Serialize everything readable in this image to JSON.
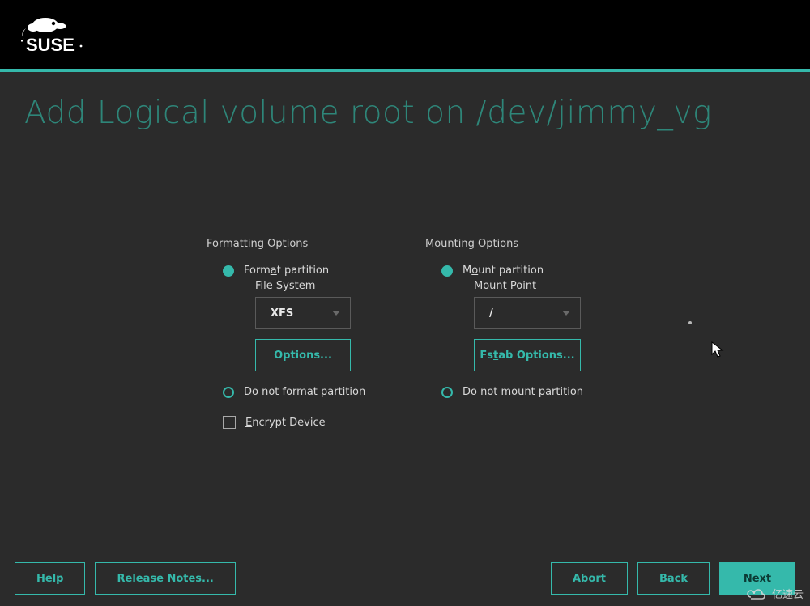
{
  "brand": "SUSE",
  "page_title": "Add Logical volume root on /dev/jimmy_vg",
  "formatting": {
    "group_label": "Formatting Options",
    "format_partition": {
      "pre": "Form",
      "u": "a",
      "post": "t partition",
      "selected": true
    },
    "file_system_label": {
      "pre": "File ",
      "u": "S",
      "post": "ystem"
    },
    "file_system_value": "XFS",
    "options_button": "Options...",
    "no_format": {
      "u": "D",
      "post": "o not format partition",
      "selected": false
    },
    "encrypt": {
      "u": "E",
      "post": "ncrypt Device",
      "checked": false
    }
  },
  "mounting": {
    "group_label": "Mounting Options",
    "mount_partition": {
      "pre": "M",
      "u": "o",
      "post": "unt partition",
      "selected": true
    },
    "mount_point_label": {
      "u": "M",
      "post": "ount Point"
    },
    "mount_point_value": "/",
    "fstab_button": {
      "pre": "Fs",
      "u": "t",
      "post": "ab Options..."
    },
    "no_mount": {
      "label": "Do not mount partition",
      "selected": false
    }
  },
  "footer": {
    "help": {
      "u": "H",
      "post": "elp"
    },
    "release_notes": {
      "pre": "Re",
      "u": "l",
      "post": "ease Notes..."
    },
    "abort": {
      "pre": "Abo",
      "u": "r",
      "post": "t"
    },
    "back": {
      "u": "B",
      "post": "ack"
    },
    "next": {
      "u": "N",
      "post": "ext"
    }
  },
  "watermark": "亿速云",
  "colors": {
    "accent": "#35b9ab",
    "bg": "#2b2b2b"
  }
}
